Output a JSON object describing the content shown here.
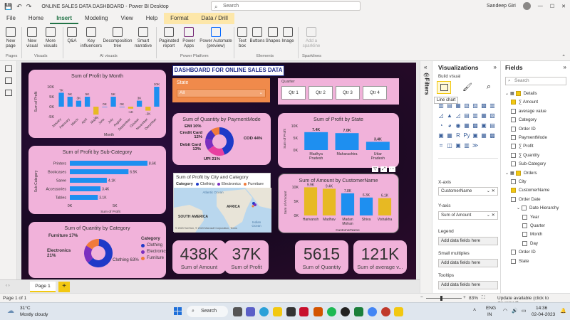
{
  "window": {
    "title": "ONLINE SALES DATA DASHBOARD - Power BI Desktop",
    "search_placeholder": "Search",
    "user": "Sandeep Giri"
  },
  "menu": {
    "file": "File",
    "home": "Home",
    "insert": "Insert",
    "modeling": "Modeling",
    "view": "View",
    "help": "Help",
    "format": "Format",
    "data_drill": "Data / Drill"
  },
  "ribbon": {
    "new_page": "New page",
    "new_visual": "New visual",
    "more_visuals": "More visuals",
    "qa": "Q&A",
    "key_influencers": "Key influencers",
    "decomposition_tree": "Decomposition tree",
    "smart_narrative": "Smart narrative",
    "paginated_report": "Paginated report",
    "power_apps": "Power Apps",
    "power_automate": "Power Automate (preview)",
    "text_box": "Text box",
    "buttons": "Buttons",
    "shapes": "Shapes",
    "image": "Image",
    "add_sparkline": "Add a sparkline",
    "groups": {
      "pages": "Pages",
      "visuals": "Visuals",
      "ai_visuals": "AI visuals",
      "power_platform": "Power Platform",
      "elements": "Elements",
      "sparklines": "Sparklines"
    }
  },
  "dashboard": {
    "banner": "DASHBOARD FOR ONLINE SALES DATA",
    "state_slicer": {
      "label": "State",
      "value": "All"
    },
    "quarter_slicer": {
      "label": "Quarter",
      "options": [
        "Qtr 1",
        "Qtr 2",
        "Qtr 3",
        "Qtr 4"
      ]
    },
    "profit_by_month": {
      "title": "Sum of Profit by Month",
      "ylabel": "Sum of Profit",
      "xlabel": "Month"
    },
    "profit_by_subcat": {
      "title": "Sum of Profit by Sub-Category",
      "ylabel": "Sub-Category",
      "xlabel": "Sum of Profit",
      "x_ticks": [
        "0K",
        "5K"
      ]
    },
    "qty_by_category": {
      "title": "Sum of Quantity by Category",
      "legend_title": "Category",
      "label_furniture": "Furniture 17%",
      "label_electronics": "Electronics 21%",
      "label_clothing": "Clothing 63%"
    },
    "qty_by_payment": {
      "title": "Sum of Quantity by PaymentMode",
      "label_emi": "EMI 10%",
      "label_cc": "Credit Card 12%",
      "label_dc": "Debit Card 13%",
      "label_upi": "UPI 21%",
      "label_cod": "COD 44%"
    },
    "profit_by_state": {
      "title": "Sum of Profit by State",
      "ylabel": "Sum of Profit"
    },
    "amount_by_customer": {
      "title": "Sum of Amount by CustomerName",
      "ylabel": "Sum of Amount",
      "xlabel": "CustomerName"
    },
    "map": {
      "title": "Sum of Profit by City and Category",
      "legend": "Category",
      "ocean": "Atlantic Ocean",
      "sa": "SOUTH AMERICA",
      "af": "AFRICA",
      "io": "Indian Ocean",
      "credit": "© 2023 TomTom, © 2023 Microsoft Corporation, Terms"
    },
    "kpis": [
      {
        "value": "438K",
        "label": "Sum of Amount"
      },
      {
        "value": "37K",
        "label": "Sum of Profit"
      },
      {
        "value": "5615",
        "label": "Sum of Quantity"
      },
      {
        "value": "121K",
        "label": "Sum of average v..."
      }
    ],
    "tooltip": "Line chart"
  },
  "chart_data": [
    {
      "type": "bar",
      "title": "Sum of Profit by Month",
      "categories": [
        "January",
        "February",
        "March",
        "April",
        "May",
        "June",
        "July",
        "August",
        "September",
        "October",
        "November",
        "December"
      ],
      "values": [
        7,
        5,
        3,
        5,
        -4,
        0,
        5,
        0,
        -1,
        3,
        -2,
        10
      ],
      "data_labels": [
        "7K",
        "5K",
        "3K",
        "5K",
        "-4K",
        "0K",
        "5K",
        "0K",
        "-1K",
        "3K",
        "-2K",
        "10K"
      ],
      "y_ticks": [
        "10K",
        "5K",
        "0K",
        "-5K"
      ],
      "ylim": [
        -5,
        10
      ]
    },
    {
      "type": "bar",
      "orientation": "horizontal",
      "title": "Sum of Profit by Sub-Category",
      "categories": [
        "Printers",
        "Bookcases",
        "Saree",
        "Accessories",
        "Tables"
      ],
      "values": [
        8.6,
        6.5,
        4.1,
        3.4,
        3.1
      ],
      "data_labels": [
        "8.6K",
        "6.5K",
        "4.1K",
        "3.4K",
        "3.1K"
      ]
    },
    {
      "type": "pie",
      "title": "Sum of Quantity by Category",
      "categories": [
        "Clothing",
        "Electronics",
        "Furniture"
      ],
      "values": [
        63,
        21,
        17
      ],
      "colors": [
        "#1e3ac8",
        "#7b2fbf",
        "#f07a3a"
      ]
    },
    {
      "type": "pie",
      "title": "Sum of Quantity by PaymentMode",
      "categories": [
        "COD",
        "UPI",
        "Debit Card",
        "Credit Card",
        "EMI"
      ],
      "values": [
        44,
        21,
        13,
        12,
        10
      ],
      "colors": [
        "#1e3ac8",
        "#e83fa0",
        "#7b2fbf",
        "#4a2fbf",
        "#f07a3a"
      ]
    },
    {
      "type": "bar",
      "title": "Sum of Profit by State",
      "categories": [
        "Madhya Pradesh",
        "Maharashtra",
        "Uttar Pradesh"
      ],
      "values": [
        7.4,
        7.0,
        3.4
      ],
      "data_labels": [
        "7.4K",
        "7.0K",
        "3.4K"
      ],
      "y_ticks": [
        "10K",
        "5K",
        "0K"
      ],
      "ylim": [
        0,
        10
      ]
    },
    {
      "type": "bar",
      "title": "Sum of Amount by CustomerName",
      "categories": [
        "Harivansh",
        "Madhav",
        "Madan Mohan",
        "Shiva",
        "Vishakha"
      ],
      "values": [
        9.9,
        9.4,
        7.8,
        6.3,
        6.1
      ],
      "data_labels": [
        "9.9K",
        "9.4K",
        "7.8K",
        "6.3K",
        "6.1K"
      ],
      "highlight": [
        true,
        true,
        false,
        false,
        true
      ],
      "y_ticks": [
        "10K",
        "5K",
        "0K"
      ],
      "ylim": [
        0,
        10
      ]
    }
  ],
  "viz_pane": {
    "title": "Visualizations",
    "build": "Build visual",
    "xaxis": "X-axis",
    "xaxis_field": "CustomerName",
    "yaxis": "Y-axis",
    "yaxis_field": "Sum of Amount",
    "legend": "Legend",
    "legend_drop": "Add data fields here",
    "small_multiples": "Small multiples",
    "sm_drop": "Add data fields here",
    "tooltips": "Tooltips",
    "tt_drop": "Add data fields here"
  },
  "filters": {
    "label": "Filters"
  },
  "fields_pane": {
    "title": "Fields",
    "search_placeholder": "Search",
    "items": [
      {
        "label": "Details",
        "indent": 0,
        "checked": "on",
        "table": true
      },
      {
        "label": "∑ Amount",
        "indent": 1,
        "checked": "on"
      },
      {
        "label": "average value",
        "indent": 1,
        "checked": "off"
      },
      {
        "label": "Category",
        "indent": 1,
        "checked": "off"
      },
      {
        "label": "Order ID",
        "indent": 1,
        "checked": "off"
      },
      {
        "label": "PaymentMode",
        "indent": 1,
        "checked": "off"
      },
      {
        "label": "∑ Profit",
        "indent": 1,
        "checked": "off"
      },
      {
        "label": "∑ Quantity",
        "indent": 1,
        "checked": "off"
      },
      {
        "label": "Sub-Category",
        "indent": 1,
        "checked": "off"
      },
      {
        "label": "Orders",
        "indent": 0,
        "checked": "on",
        "table": true
      },
      {
        "label": "City",
        "indent": 1,
        "checked": "off"
      },
      {
        "label": "CustomerName",
        "indent": 1,
        "checked": "on"
      },
      {
        "label": "Order Date",
        "indent": 1,
        "checked": "off"
      },
      {
        "label": "Date Hierarchy",
        "indent": 2,
        "checked": "off"
      },
      {
        "label": "Year",
        "indent": 3,
        "checked": "off"
      },
      {
        "label": "Quarter",
        "indent": 3,
        "checked": "off"
      },
      {
        "label": "Month",
        "indent": 3,
        "checked": "off"
      },
      {
        "label": "Day",
        "indent": 3,
        "checked": "off"
      },
      {
        "label": "Order ID",
        "indent": 1,
        "checked": "off"
      },
      {
        "label": "State",
        "indent": 1,
        "checked": "off"
      }
    ]
  },
  "page_tabs": {
    "page1": "Page 1",
    "add": "+"
  },
  "status": {
    "left": "Page 1 of 1",
    "zoom": "83%",
    "update": "Update available (click to download)"
  },
  "taskbar": {
    "temp": "31°C",
    "weather": "Mostly cloudy",
    "search": "Search",
    "lang1": "ENG",
    "lang2": "IN",
    "time": "14:36",
    "date": "02-04-2023"
  },
  "colors": {
    "accent": "#217346",
    "card": "#f1b2da",
    "bar": "#1e8ff0",
    "highlight": "#e7b923",
    "ctx_tab": "#fde7a9"
  }
}
